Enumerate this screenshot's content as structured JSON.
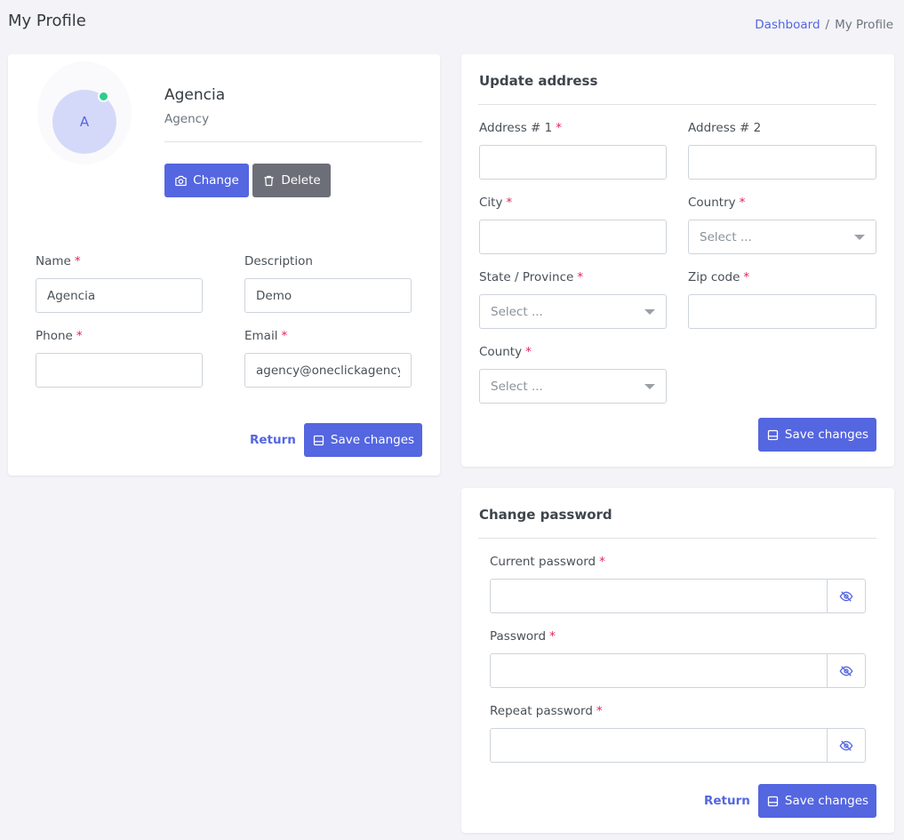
{
  "header": {
    "title": "My Profile",
    "breadcrumb": {
      "link": "Dashboard",
      "separator": "/",
      "current": "My Profile"
    }
  },
  "profile": {
    "avatar_initial": "A",
    "name": "Agencia",
    "role": "Agency",
    "change_label": "Change",
    "delete_label": "Delete",
    "fields": {
      "name": {
        "label": "Name",
        "required": "*",
        "value": "Agencia"
      },
      "description": {
        "label": "Description",
        "value": "Demo"
      },
      "phone": {
        "label": "Phone",
        "required": "*",
        "value": ""
      },
      "email": {
        "label": "Email",
        "required": "*",
        "value": "agency@oneclickagency.us"
      }
    },
    "return_label": "Return",
    "save_label": "Save changes"
  },
  "address": {
    "title": "Update address",
    "address1": {
      "label": "Address # 1",
      "required": "*",
      "value": ""
    },
    "address2": {
      "label": "Address # 2",
      "value": ""
    },
    "city": {
      "label": "City",
      "required": "*",
      "value": ""
    },
    "country": {
      "label": "Country",
      "required": "*",
      "placeholder": "Select ..."
    },
    "state": {
      "label": "State / Province",
      "required": "*",
      "placeholder": "Select ..."
    },
    "zip": {
      "label": "Zip code",
      "required": "*",
      "value": ""
    },
    "county": {
      "label": "County",
      "required": "*",
      "placeholder": "Select ..."
    },
    "save_label": "Save changes"
  },
  "password": {
    "title": "Change password",
    "current": {
      "label": "Current password",
      "required": "*"
    },
    "new": {
      "label": "Password",
      "required": "*"
    },
    "repeat": {
      "label": "Repeat password",
      "required": "*"
    },
    "return_label": "Return",
    "save_label": "Save changes"
  },
  "colors": {
    "primary": "#5466e0",
    "secondary": "#6c6f78",
    "required": "#e0245e",
    "online": "#2ecc8f"
  },
  "icons": {
    "change": "camera-icon",
    "delete": "trash-icon",
    "save": "save-icon",
    "toggle_password": "eye-off-icon"
  }
}
